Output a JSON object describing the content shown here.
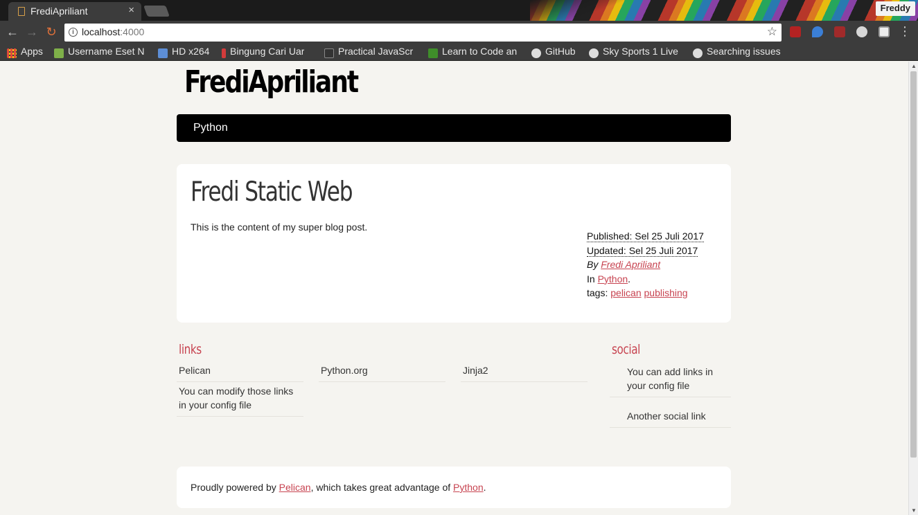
{
  "browser": {
    "tab_title": "FrediApriliant",
    "tab_close": "×",
    "profile_name": "Freddy",
    "url_host": "localhost",
    "url_port": ":4000",
    "back_icon": "←",
    "forward_icon": "→",
    "reload_icon": "↻",
    "star_icon": "☆",
    "menu_icon": "⋮",
    "info_icon": "i",
    "bookmarks": [
      {
        "label": "Apps",
        "icon_color": "#e04a3c"
      },
      {
        "label": "Username Eset N",
        "icon_color": "#7fb049"
      },
      {
        "label": "HD x264",
        "icon_color": "#5d8ed6"
      },
      {
        "label": "Bingung Cari Uar",
        "icon_color": "#d23b3b"
      },
      {
        "label": "Practical JavaScr",
        "icon_color": "#333333"
      },
      {
        "label": "Learn to Code an",
        "icon_color": "#3f8e2a"
      },
      {
        "label": "GitHub",
        "icon_color": "#222222"
      },
      {
        "label": "Sky Sports 1 Live",
        "icon_color": "#dddddd"
      },
      {
        "label": "Searching issues",
        "icon_color": "#222222"
      }
    ]
  },
  "site": {
    "title": "FrediApriliant",
    "menu": [
      "Python"
    ]
  },
  "article": {
    "title": "Fredi Static Web",
    "content": "This is the content of my super blog post.",
    "published": "Published: Sel 25 Juli 2017",
    "updated": "Updated: Sel 25 Juli 2017",
    "by_label": "By",
    "author": "Fredi Apriliant",
    "in_label": "In",
    "category": "Python",
    "category_suffix": ".",
    "tags_label": "tags:",
    "tags": [
      "pelican",
      "publishing"
    ]
  },
  "blogroll": {
    "title": "links",
    "items": [
      "Pelican",
      "Python.org",
      "Jinja2",
      "You can modify those links in your config file"
    ]
  },
  "social": {
    "title": "social",
    "items": [
      "You can add links in your config file",
      "Another social link"
    ]
  },
  "footer": {
    "prefix": "Proudly powered by",
    "pelican": "Pelican",
    "middle": ", which takes great advantage of",
    "python": "Python",
    "suffix": "."
  },
  "colors": {
    "accent": "#c74350",
    "page_bg": "#f5f4f0",
    "menubar_bg": "#000000"
  }
}
